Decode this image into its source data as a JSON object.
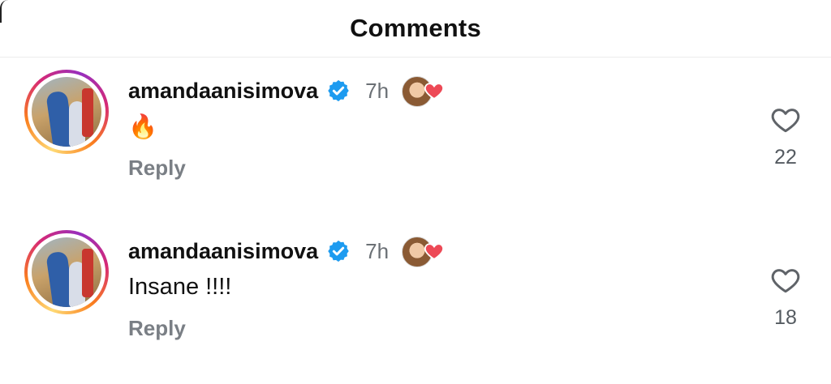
{
  "header": {
    "title": "Comments"
  },
  "comments": [
    {
      "username": "amandaanisimova",
      "time": "7h",
      "text": "🔥",
      "reply_label": "Reply",
      "like_count": "22"
    },
    {
      "username": "amandaanisimova",
      "time": "7h",
      "text": "Insane !!!!",
      "reply_label": "Reply",
      "like_count": "18"
    }
  ],
  "colors": {
    "verified_blue": "#1d9bf0",
    "heart_red": "#ed4956",
    "muted_text": "#6b7075"
  },
  "icons": {
    "verified": "verified-badge-icon",
    "creator_like": "creator-heart-icon",
    "like": "heart-outline-icon"
  }
}
